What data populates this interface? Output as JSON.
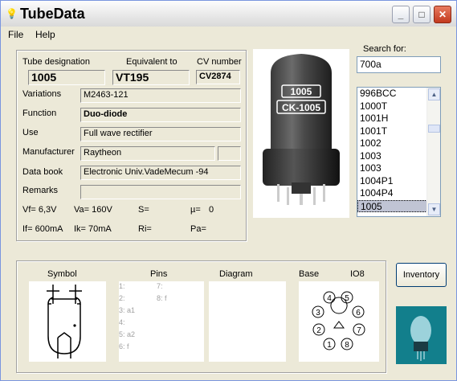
{
  "window": {
    "title": "TubeData",
    "buttons": {
      "minimize": "_",
      "maximize": "□",
      "close": "✕"
    }
  },
  "menu": {
    "file": "File",
    "help": "Help"
  },
  "search": {
    "label": "Search for:",
    "value": "700a"
  },
  "list": {
    "items": [
      "996BCC",
      "1000T",
      "1001H",
      "1001T",
      "1002",
      "1003",
      "1003",
      "1004P1",
      "1004P4",
      "1005"
    ],
    "selected_index": 9
  },
  "tube": {
    "designation_label": "Tube designation",
    "designation": "1005",
    "equivalent_label": "Equivalent to",
    "equivalent": "VT195",
    "cv_label": "CV number",
    "cv": "CV2874",
    "variations_label": "Variations",
    "variations": "M2463-121",
    "function_label": "Function",
    "function": "Duo-diode",
    "use_label": "Use",
    "use": "Full wave rectifier",
    "manufacturer_label": "Manufacturer",
    "manufacturer": "Raytheon",
    "manufacturer_extra": "",
    "databook_label": "Data book",
    "databook": "Electronic Univ.VadeMecum -94",
    "remarks_label": "Remarks",
    "remarks": ""
  },
  "specs": {
    "vf": "Vf= 6,3V",
    "va": "Va= 160V",
    "s": "S=",
    "mu": "µ=",
    "mu_val": "0",
    "if": "If= 600mA",
    "ik": "Ik=  70mA",
    "ri": "Ri=",
    "pa": "Pa="
  },
  "photo": {
    "label1": "1005",
    "label2": "CK-1005"
  },
  "bottom": {
    "symbol_label": "Symbol",
    "pins_label": "Pins",
    "diagram_label": "Diagram",
    "base_label": "Base",
    "base_type": "IO8",
    "pins_left": [
      "1:",
      "2:",
      "3: a1",
      "4:",
      "5: a2",
      "6: f"
    ],
    "pins_right": [
      "7:",
      "8: f"
    ],
    "base_pins": [
      "1",
      "2",
      "3",
      "4",
      "5",
      "6",
      "7",
      "8"
    ]
  },
  "inventory_button": "Inventory",
  "colors": {
    "titlebar": "#e7e7e7",
    "window_bg": "#ece9d8",
    "close": "#c2391e",
    "selection": "#c0c4d4"
  }
}
